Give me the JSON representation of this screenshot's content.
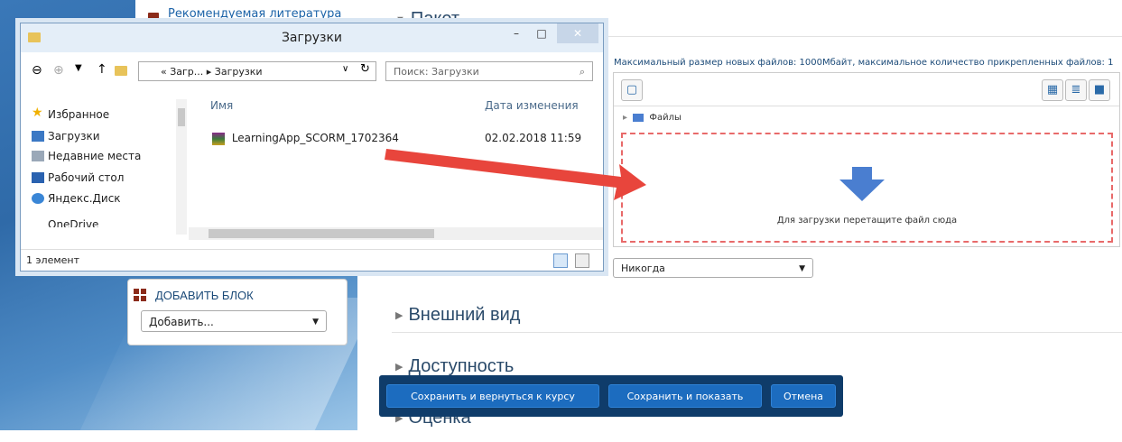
{
  "sidebar": {
    "recommended_link": "Рекомендуемая литература",
    "add_block": {
      "title": "ДОБАВИТЬ БЛОК",
      "select_value": "Добавить..."
    }
  },
  "sections": {
    "package": "Пакет",
    "appearance": "Внешний вид",
    "availability": "Доступность",
    "grade": "Оценка"
  },
  "filemanager": {
    "info": "Максимальный размер новых файлов: 1000Мбайт, максимальное количество прикрепленных файлов: 1",
    "crumb": "Файлы",
    "drop_text": "Для загрузки перетащите файл сюда"
  },
  "never_select": "Никогда",
  "buttons": {
    "save_return": "Сохранить и вернуться к курсу",
    "save_show": "Сохранить и показать",
    "cancel": "Отмена"
  },
  "explorer": {
    "title": "Загрузки",
    "address": "« Загр... ▸ Загрузки",
    "search_placeholder": "Поиск: Загрузки",
    "nav": {
      "favorites": "Избранное",
      "downloads": "Загрузки",
      "recent": "Недавние места",
      "desktop": "Рабочий стол",
      "yandex": "Яндекс.Диск",
      "onedrive": "OneDrive"
    },
    "columns": {
      "name": "Имя",
      "date": "Дата изменения"
    },
    "file": {
      "name": "LearningApp_SCORM_1702364",
      "date": "02.02.2018 11:59"
    },
    "status": "1 элемент"
  },
  "colors": {
    "accent": "#1c6cbf",
    "drop_border": "#e86a6a",
    "arrow": "#e8453c"
  }
}
